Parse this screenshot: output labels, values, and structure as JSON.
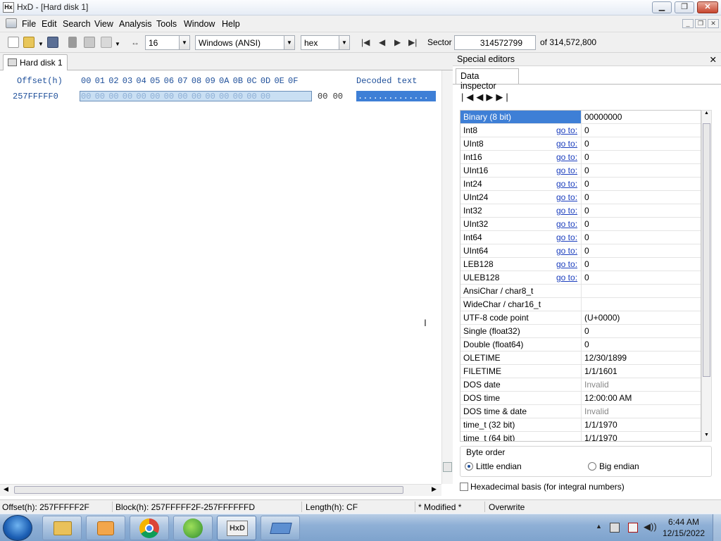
{
  "window": {
    "title": "HxD - [Hard disk 1]",
    "app_icon_text": "Hx"
  },
  "menu": [
    "File",
    "Edit",
    "Search",
    "View",
    "Analysis",
    "Tools",
    "Window",
    "Help"
  ],
  "toolbar": {
    "bytes_per_row": "16",
    "charset": "Windows (ANSI)",
    "offset_base": "hex",
    "sector_label": "Sector",
    "sector_value": "314572799",
    "sector_total": "of 314,572,800"
  },
  "document": {
    "tab_label": "Hard disk 1",
    "offset_header": "Offset(h)",
    "column_headers": "00 01 02 03 04 05 06 07 08 09 0A 0B 0C 0D 0E 0F",
    "decoded_header": "Decoded text",
    "row_offset": "257FFFFF0",
    "row_bytes_selected": "00 00 00 00 00 00 00 00 00 00 00 00 00 00",
    "row_bytes_rest": "00 00",
    "row_decoded": ".............."
  },
  "special_editors": {
    "header": "Special editors",
    "tab": "Data inspector",
    "goto_label": "go to:",
    "rows": [
      {
        "name": "Binary (8 bit)",
        "value": "00000000",
        "goto": false,
        "selected": true
      },
      {
        "name": "Int8",
        "value": "0",
        "goto": true
      },
      {
        "name": "UInt8",
        "value": "0",
        "goto": true
      },
      {
        "name": "Int16",
        "value": "0",
        "goto": true
      },
      {
        "name": "UInt16",
        "value": "0",
        "goto": true
      },
      {
        "name": "Int24",
        "value": "0",
        "goto": true
      },
      {
        "name": "UInt24",
        "value": "0",
        "goto": true
      },
      {
        "name": "Int32",
        "value": "0",
        "goto": true
      },
      {
        "name": "UInt32",
        "value": "0",
        "goto": true
      },
      {
        "name": "Int64",
        "value": "0",
        "goto": true
      },
      {
        "name": "UInt64",
        "value": "0",
        "goto": true
      },
      {
        "name": "LEB128",
        "value": "0",
        "goto": true
      },
      {
        "name": "ULEB128",
        "value": "0",
        "goto": true
      },
      {
        "name": "AnsiChar / char8_t",
        "value": "",
        "goto": false
      },
      {
        "name": "WideChar / char16_t",
        "value": "",
        "goto": false
      },
      {
        "name": "UTF-8 code point",
        "value": "   (U+0000)",
        "goto": false
      },
      {
        "name": "Single (float32)",
        "value": "0",
        "goto": false
      },
      {
        "name": "Double (float64)",
        "value": "0",
        "goto": false
      },
      {
        "name": "OLETIME",
        "value": "12/30/1899",
        "goto": false
      },
      {
        "name": "FILETIME",
        "value": "1/1/1601",
        "goto": false
      },
      {
        "name": "DOS date",
        "value": "Invalid",
        "goto": false,
        "dim": true
      },
      {
        "name": "DOS time",
        "value": "12:00:00 AM",
        "goto": false
      },
      {
        "name": "DOS time & date",
        "value": "Invalid",
        "goto": false,
        "dim": true
      },
      {
        "name": "time_t (32 bit)",
        "value": "1/1/1970",
        "goto": false
      },
      {
        "name": "time_t (64 bit)",
        "value": "1/1/1970",
        "goto": false
      }
    ],
    "byte_order_label": "Byte order",
    "little_endian": "Little endian",
    "big_endian": "Big endian",
    "hex_basis": "Hexadecimal basis (for integral numbers)"
  },
  "status": {
    "offset": "Offset(h): 257FFFFF2F",
    "block": "Block(h): 257FFFFF2F-257FFFFFFD",
    "length": "Length(h): CF",
    "modified": "* Modified *",
    "mode": "Overwrite"
  },
  "taskbar": {
    "time": "6:44 AM",
    "date": "12/15/2022"
  }
}
